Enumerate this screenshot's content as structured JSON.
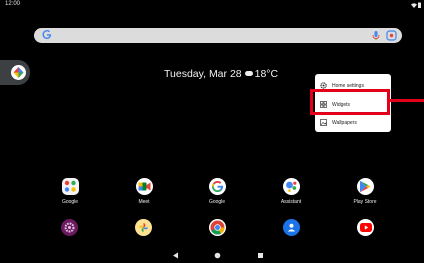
{
  "status": {
    "time": "12:00"
  },
  "date_widget": {
    "date": "Tuesday, Mar 28",
    "temp": "18°C"
  },
  "context_menu": {
    "items": [
      {
        "label": "Home settings",
        "icon": "gear-icon"
      },
      {
        "label": "Widgets",
        "icon": "widgets-icon"
      },
      {
        "label": "Wallpapers",
        "icon": "wallpaper-icon"
      }
    ]
  },
  "apps": [
    {
      "label": "Google",
      "icon": "google-folder-icon"
    },
    {
      "label": "Meet",
      "icon": "meet-icon"
    },
    {
      "label": "Google",
      "icon": "google-icon"
    },
    {
      "label": "Assistant",
      "icon": "assistant-icon"
    },
    {
      "label": "Play Store",
      "icon": "play-store-icon"
    }
  ],
  "dock": [
    "settings-icon",
    "photos-icon",
    "chrome-icon",
    "contacts-icon",
    "youtube-icon"
  ],
  "nav": [
    "back-icon",
    "home-icon",
    "recents-icon"
  ],
  "colors": {
    "highlight": "#e3001b",
    "background": "#000000",
    "search_bar": "#dcdcdc"
  }
}
